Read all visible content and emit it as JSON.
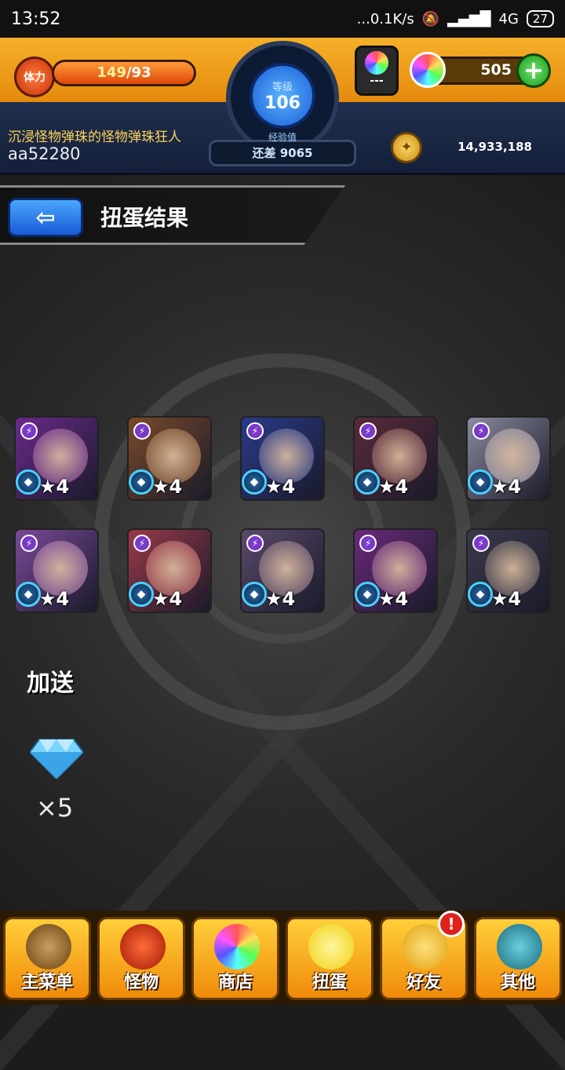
{
  "status_bar": {
    "time": "13:52",
    "network_speed": "...0.1K/s",
    "signal": "4G",
    "battery": "27"
  },
  "header": {
    "stamina_label": "体力",
    "stamina_value": "149",
    "stamina_max": "/93",
    "level_label": "等级",
    "level": "106",
    "exp_label": "经验值",
    "exp_remaining": "还差 9065",
    "ticket_count": "---",
    "orb_count": "505",
    "add_label": "+",
    "player_title": "沉浸怪物弹珠的怪物弹珠狂人",
    "player_id": "aa52280",
    "gold_count": "14,933,188"
  },
  "page": {
    "back_label": "⇦",
    "title": "扭蛋结果"
  },
  "results": [
    {
      "stars": "★4",
      "color": "#6a2a8a"
    },
    {
      "stars": "★4",
      "color": "#7a4a2a"
    },
    {
      "stars": "★4",
      "color": "#2a3a8a"
    },
    {
      "stars": "★4",
      "color": "#5a2a3a"
    },
    {
      "stars": "★4",
      "color": "#8a8aa0"
    },
    {
      "stars": "★4",
      "color": "#7a4a9a"
    },
    {
      "stars": "★4",
      "color": "#9a3a4a"
    },
    {
      "stars": "★4",
      "color": "#5a4a6a"
    },
    {
      "stars": "★4",
      "color": "#6a2a7a"
    },
    {
      "stars": "★4",
      "color": "#3a3a4a"
    }
  ],
  "bonus": {
    "label": "加送",
    "count": "×5"
  },
  "nav": [
    {
      "label": "主菜单",
      "icon": "house-icon"
    },
    {
      "label": "怪物",
      "icon": "monster-icon"
    },
    {
      "label": "商店",
      "icon": "orb-icon"
    },
    {
      "label": "扭蛋",
      "icon": "egg-icon"
    },
    {
      "label": "好友",
      "icon": "friends-icon"
    },
    {
      "label": "其他",
      "icon": "other-icon"
    }
  ],
  "friends_badge": "!"
}
